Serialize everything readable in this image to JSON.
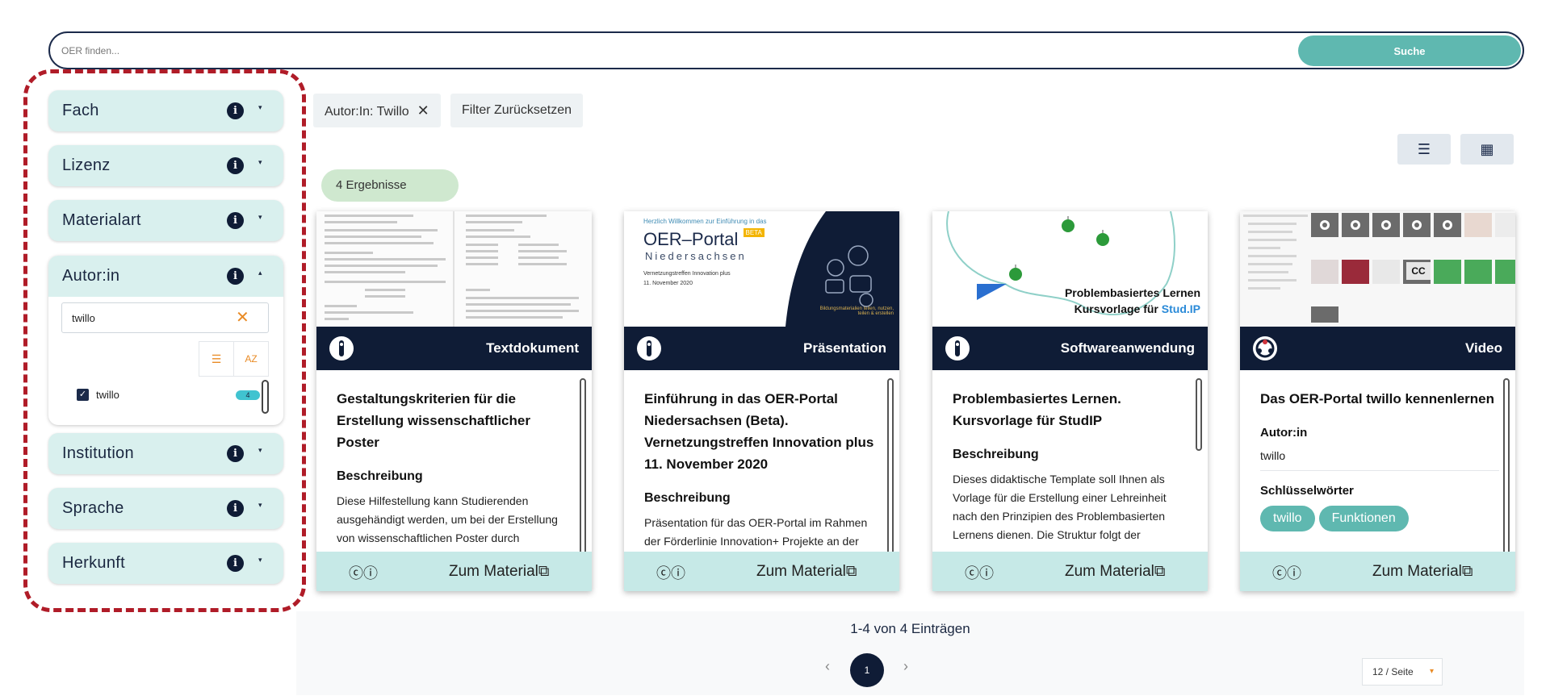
{
  "search": {
    "placeholder": "OER finden...",
    "button_label": "Suche"
  },
  "facets": {
    "fach": "Fach",
    "lizenz": "Lizenz",
    "materialart": "Materialart",
    "autorin": "Autor:in",
    "institution": "Institution",
    "sprache": "Sprache",
    "herkunft": "Herkunft",
    "info_glyph": "i",
    "caret_down": "▾",
    "caret_up": "▴"
  },
  "author_filter": {
    "input_value": "twillo",
    "clear_glyph": "✕",
    "sort_list_glyph": "☰",
    "sort_az_glyph": "AZ",
    "checkbox_glyph": "✓",
    "option_label": "twillo",
    "option_count": "4"
  },
  "active_filters": {
    "chip_label": "Autor:In: Twillo",
    "chip_close_glyph": "✕",
    "reset_label": "Filter Zurücksetzen"
  },
  "view_toggle": {
    "list_glyph": "☰",
    "grid_glyph": "▦"
  },
  "results_count": "4 Ergebnisse",
  "cards": [
    {
      "type_label": "Textdokument",
      "title": "Gestaltungskriterien für die Erstellung wissenschaftlicher Poster",
      "section": "Beschreibung",
      "description": "Diese Hilfestellung kann Studierenden ausgehändigt werden, um bei der Erstellung von wissenschaftlichen Poster durch Gestaltungshinweise zu unterstützen. Die",
      "license_glyphs": "ⓒⓘ",
      "link_label": "Zum Material",
      "link_glyph": "⧉"
    },
    {
      "type_label": "Präsentation",
      "title": "Einführung in das OER-Portal Niedersachsen (Beta). Vernetzungstreffen Innovation plus 11. November 2020",
      "section": "Beschreibung",
      "description": "Präsentation für das OER-Portal im Rahmen der Förderlinie Innovation+ Projekte an der",
      "thumb_title": "OER–Portal",
      "thumb_badge": "BETA",
      "thumb_subtitle": "Niedersachsen",
      "thumb_line1": "Vernetzungstreffen Innovation plus",
      "thumb_line2": "11. November 2020",
      "thumb_header": "Herzlich Willkommen zur Einführung in das",
      "thumb_tagline": "Bildungsmaterialien teilen, nutzen, teilen & erstellen",
      "license_glyphs": "ⓒⓘ",
      "link_label": "Zum Material",
      "link_glyph": "⧉"
    },
    {
      "type_label": "Softwareanwendung",
      "title": "Problembasiertes Lernen. Kursvorlage für StudIP",
      "section": "Beschreibung",
      "description": "Dieses didaktische Template soll Ihnen als Vorlage für die Erstellung einer Lehreinheit nach den Prinzipien des Problembasierten Lernens dienen. Die Struktur folgt der",
      "thumb_line1": "Problembasiertes Lernen",
      "thumb_line2a": "Kursvorlage für ",
      "thumb_line2b": "Stud.IP",
      "license_glyphs": "ⓒⓘ",
      "link_label": "Zum Material",
      "link_glyph": "⧉"
    },
    {
      "type_label": "Video",
      "title": "Das OER-Portal twillo kennenlernen",
      "author_head": "Autor:in",
      "author_value": "twillo",
      "keywords_head": "Schlüsselwörter",
      "keywords": [
        "twillo",
        "Funktionen"
      ],
      "thumb_cc": "CC",
      "license_glyphs": "ⓒⓘ",
      "link_label": "Zum Material",
      "link_glyph": "⧉"
    }
  ],
  "pagination": {
    "summary": "1-4 von 4 Einträgen",
    "prev_glyph": "‹",
    "current_page": "1",
    "next_glyph": "›",
    "per_page": "12 / Seite",
    "per_page_caret": "▾"
  },
  "colors": {
    "navy": "#0f1c36",
    "teal": "#5fb8b0",
    "facet_bg": "#d9f0ee",
    "footer_bg": "#c6e9e7",
    "highlight_red": "#b01c28",
    "accent_orange": "#e98b26"
  }
}
